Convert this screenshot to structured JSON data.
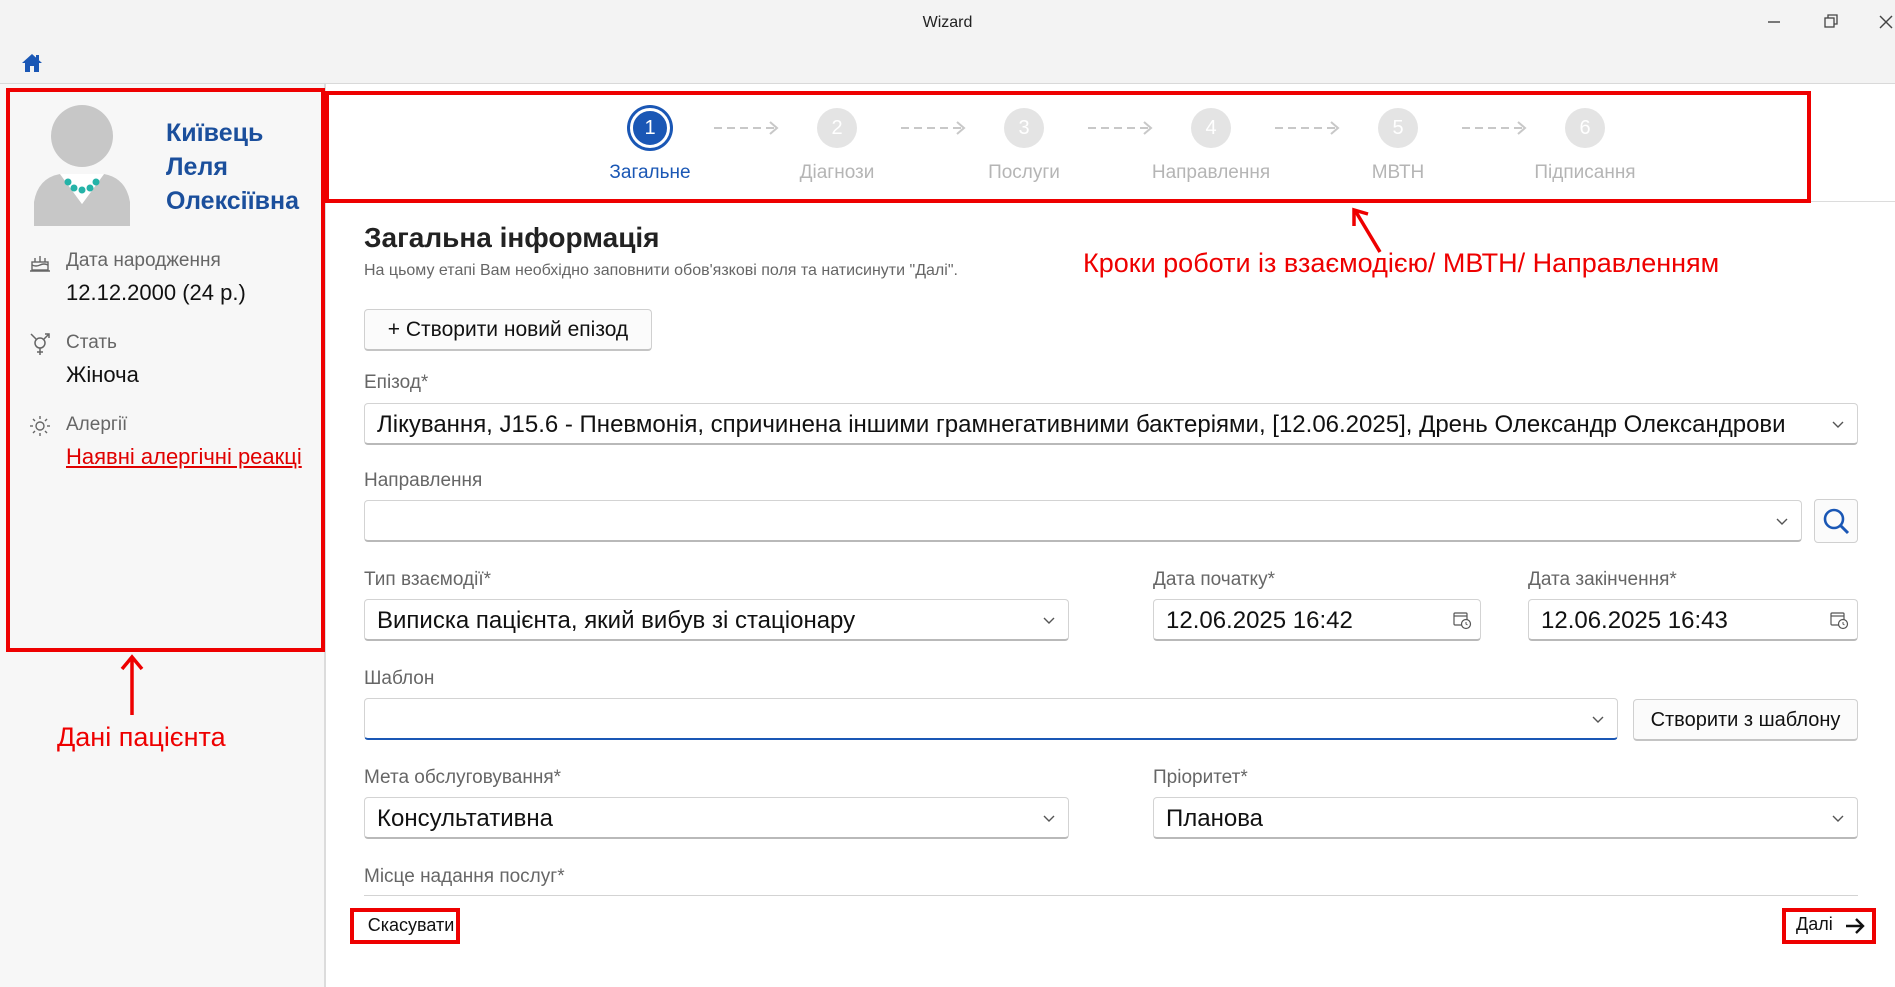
{
  "window": {
    "title": "Wizard"
  },
  "patient": {
    "name_line1": "Київець",
    "name_line2": "Леля",
    "name_line3": "Олексіївна",
    "birth_label": "Дата народження",
    "birth_value": "12.12.2000 (24 р.)",
    "sex_label": "Стать",
    "sex_value": "Жіноча",
    "allergy_label": "Алергії",
    "allergy_link": "Наявні алергічні реакці"
  },
  "steps": [
    {
      "number": "1",
      "label": "Загальне",
      "active": true
    },
    {
      "number": "2",
      "label": "Діагнози",
      "active": false
    },
    {
      "number": "3",
      "label": "Послуги",
      "active": false
    },
    {
      "number": "4",
      "label": "Направлення",
      "active": false
    },
    {
      "number": "5",
      "label": "МВТН",
      "active": false
    },
    {
      "number": "6",
      "label": "Підписання",
      "active": false
    }
  ],
  "annotations": {
    "steps_note": "Кроки роботи із взаємодією/ МВТН/ Направленням",
    "patient_note": "Дані пацієнта",
    "color": "#ee0000"
  },
  "form": {
    "title": "Загальна інформація",
    "subtitle": "На цьому етапі Вам необхідно заповнити обов'язкові поля та натисинути \"Далі\".",
    "new_episode_button": "+ Створити новий епізод",
    "episode_label": "Епізод*",
    "episode_value": "Лікування, J15.6 - Пневмонія, спричинена іншими грамнегативними бактеріями, [12.06.2025], Дрень Олександр Олександрови",
    "referral_label": "Направлення",
    "referral_value": "",
    "interaction_type_label": "Тип взаємодії*",
    "interaction_type_value": "Виписка пацієнта, який вибув зі стаціонару",
    "start_date_label": "Дата початку*",
    "start_date_value": "12.06.2025 16:42",
    "end_date_label": "Дата закінчення*",
    "end_date_value": "12.06.2025 16:43",
    "template_label": "Шаблон",
    "template_value": "",
    "template_button": "Створити з шаблону",
    "purpose_label": "Мета обслуговування*",
    "purpose_value": "Консультативна",
    "priority_label": "Пріоритет*",
    "priority_value": "Планова",
    "place_label": "Місце надання послуг*"
  },
  "footer": {
    "cancel_label": "Скасувати",
    "next_label": "Далі"
  },
  "colors": {
    "accent": "#1a57b5",
    "patient_name": "#1b4f9c",
    "annotation": "#ee0000"
  }
}
